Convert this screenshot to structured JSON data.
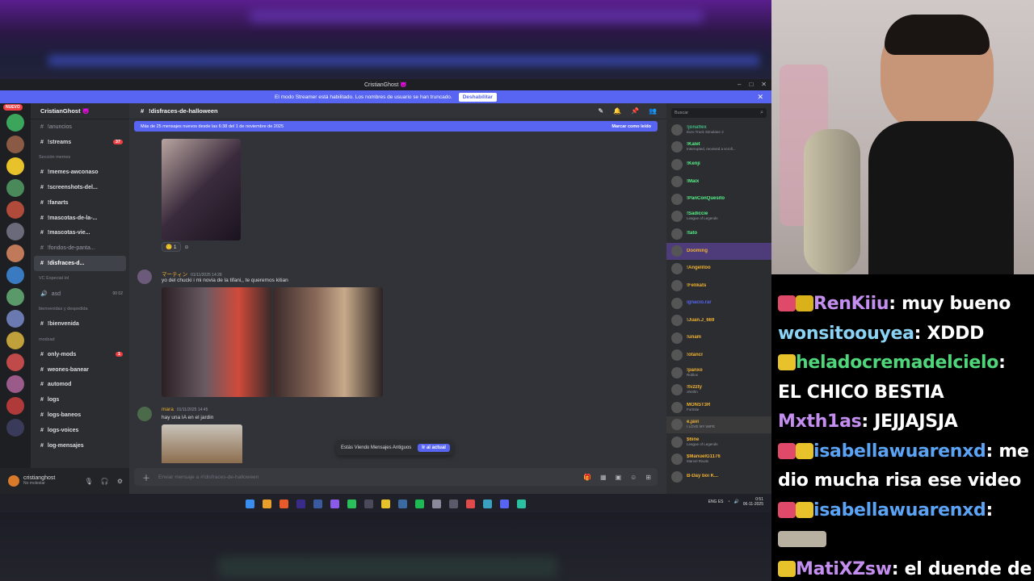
{
  "window": {
    "title": "CristianGhost 😈"
  },
  "streamer_banner": {
    "text": "El modo Streamer está habilitado. Los nombres de usuario se han truncado.",
    "button": "Deshabilitar"
  },
  "server": {
    "name": "CristianGhost 😈",
    "nuevo": "NUEVO"
  },
  "channels": [
    {
      "label": "!anuncios",
      "type": "channel",
      "bright": false
    },
    {
      "label": "!streams",
      "type": "channel",
      "bright": true,
      "badge": "37"
    },
    {
      "label": "Sección memes",
      "type": "category"
    },
    {
      "label": "!memes-awconaso",
      "type": "channel",
      "bright": true
    },
    {
      "label": "!screenshots-del...",
      "type": "channel",
      "bright": true
    },
    {
      "label": "!fanarts",
      "type": "channel",
      "bright": true
    },
    {
      "label": "!mascotas-de-la-...",
      "type": "channel",
      "bright": true
    },
    {
      "label": "!mascotas-vie...",
      "type": "channel",
      "bright": true
    },
    {
      "label": "!fondos-de-panta...",
      "type": "channel",
      "bright": false
    },
    {
      "label": "!disfraces-d...",
      "type": "selected"
    },
    {
      "label": "VC Especial lol",
      "type": "category"
    },
    {
      "label": "asd",
      "type": "voice",
      "extra": "00 02"
    },
    {
      "label": "bienvenidas y despedida",
      "type": "category"
    },
    {
      "label": "!bienvenida",
      "type": "channel",
      "bright": true
    },
    {
      "label": "modzad",
      "type": "category"
    },
    {
      "label": "only-mods",
      "type": "channel",
      "bright": true,
      "badge": "1"
    },
    {
      "label": "weones-banear",
      "type": "channel",
      "bright": true
    },
    {
      "label": "automod",
      "type": "channel",
      "bright": true
    },
    {
      "label": "logs",
      "type": "channel",
      "bright": true
    },
    {
      "label": "logs-baneos",
      "type": "channel",
      "bright": true
    },
    {
      "label": "logs-voices",
      "type": "channel",
      "bright": true
    },
    {
      "label": "log-mensajes",
      "type": "channel",
      "bright": true
    }
  ],
  "user": {
    "name": "cristianghost",
    "status": "No molestar"
  },
  "chat": {
    "channel": "!disfraces-de-halloween",
    "new_banner": "Más de 25 mensajes nuevos desde las 6:38 del 1 de noviembre de 2025",
    "mark_read": "Marcar como leído",
    "reaction_count": "1",
    "msg1_author": "マーティン",
    "msg1_time": "01/11/2025 14:28",
    "msg1_text": "yo del chucki i mi novia de la tifani,, te queremos kitian",
    "msg2_author": "mara",
    "msg2_time": "01/11/2025 14:45",
    "msg2_text": "hay una IA en el jardin",
    "old_msgs": "Estás Viendo Mensajes Antiguos",
    "go_current": "Ir al actual",
    "input_placeholder": "Enviar mensaje a #!disfraces-de-halloween"
  },
  "members": {
    "search_placeholder": "Buscar",
    "list": [
      {
        "name": "!jonaflex",
        "sub": "Euro Truck Simulator 2",
        "color": "#43b581"
      },
      {
        "name": "!Kalet",
        "sub": "Interrupted, received a scroll...",
        "color": "#57f287"
      },
      {
        "name": "!Kenji",
        "sub": "",
        "color": "#57f287"
      },
      {
        "name": "!Maix",
        "sub": "",
        "color": "#57f287"
      },
      {
        "name": "!PanConQuesito",
        "sub": "",
        "color": "#57f287"
      },
      {
        "name": "!Sadiccie",
        "sub": "League of Legends",
        "color": "#57f287"
      },
      {
        "name": "!tato",
        "sub": "",
        "color": "#57f287"
      },
      {
        "name": "Dooming",
        "sub": "",
        "color": "#f0b232",
        "hl": true
      },
      {
        "name": "!Angelitoo",
        "sub": "",
        "color": "#f0b232"
      },
      {
        "name": "!Felikats",
        "sub": "",
        "color": "#f0b232"
      },
      {
        "name": "ignacio.rar",
        "sub": "",
        "color": "#5865f2"
      },
      {
        "name": "!Juan.J_669",
        "sub": "",
        "color": "#f0b232"
      },
      {
        "name": "!unam",
        "sub": "",
        "color": "#f0b232"
      },
      {
        "name": "!otancr",
        "sub": "",
        "color": "#f0b232"
      },
      {
        "name": "!panxo",
        "sub": "Roblox",
        "color": "#f0b232"
      },
      {
        "name": "!tv2zty",
        "sub": "ohnthn",
        "color": "#f0b232"
      },
      {
        "name": "MONST3R",
        "sub": "Fortnite",
        "color": "#f0b232"
      },
      {
        "name": "e.javi",
        "sub": "I LOVE MY WIFE",
        "color": "#f0b232",
        "hl2": true
      },
      {
        "name": "$6ine",
        "sub": "League of Legends",
        "color": "#f0b232"
      },
      {
        "name": "$ManuelG1176",
        "sub": "Marvel Rivals",
        "color": "#f0b232"
      },
      {
        "name": "B-Day boi K...",
        "sub": "",
        "color": "#f0b232"
      }
    ]
  },
  "tray": {
    "lang": "ENG ES",
    "time": "0:51",
    "date": "06-11-2025"
  },
  "stream_chat": [
    {
      "user": "RenKiiu",
      "color": "#c48ef0",
      "msg": "muy bueno",
      "emo": [
        "#e04a6a",
        "#d9b21a"
      ]
    },
    {
      "user": "wonsitoouyea",
      "color": "#8ad3f4",
      "msg": "XDDD",
      "emo": []
    },
    {
      "user": "heladocremadelcielo",
      "color": "#4fd67a",
      "msg": "",
      "emo": [
        "#e8c22a"
      ]
    },
    {
      "user": "",
      "color": "#fff",
      "msg": "EL CHICO BESTIA",
      "emo": []
    },
    {
      "user": "Mxth1as",
      "color": "#c48ef0",
      "msg": "JEJJAJSJA",
      "emo": []
    },
    {
      "user": "isabellawuarenxd",
      "color": "#5aa3f5",
      "msg": "me",
      "emo": [
        "#e04a6a",
        "#e8c22a"
      ]
    },
    {
      "user": "",
      "color": "#fff",
      "msg": "dio mucha risa ese video",
      "emo": []
    },
    {
      "user": "isabellawuarenxd",
      "color": "#5aa3f5",
      "msg": "",
      "emo": [
        "#e04a6a",
        "#e8c22a"
      ]
    },
    {
      "user": "",
      "color": "#fff",
      "msg": "",
      "emo": []
    },
    {
      "user": "MatiXZsw",
      "color": "#c48ef0",
      "msg": "el duende de",
      "emo": [
        "#e8c22a"
      ]
    }
  ],
  "colors": {
    "blurple": "#5865f2",
    "bg": "#313338",
    "sidebar": "#2b2d31"
  }
}
